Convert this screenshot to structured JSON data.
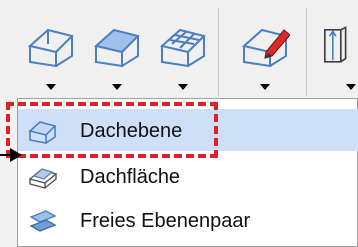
{
  "toolbar": {
    "buttons": [
      {
        "name": "roof-plane-tool",
        "icon": "house-roof-icon"
      },
      {
        "name": "roof-surface-tool",
        "icon": "house-roof-filled-icon"
      },
      {
        "name": "roof-rafter-tool",
        "icon": "house-rafter-icon"
      },
      {
        "name": "roof-edit-tool",
        "icon": "house-pencil-icon"
      },
      {
        "name": "column-tool",
        "icon": "column-icon"
      }
    ]
  },
  "menu": {
    "items": [
      {
        "label": "Dachebene",
        "icon": "roof-plane-icon",
        "highlighted": true
      },
      {
        "label": "Dachfläche",
        "icon": "roof-surface-icon",
        "highlighted": false
      },
      {
        "label": "Freies Ebenenpaar",
        "icon": "free-plane-pair-icon",
        "highlighted": false
      }
    ]
  },
  "colors": {
    "highlight": "#cde0f7",
    "annotation": "#e31e24",
    "accent_blue": "#4a7fc1"
  }
}
